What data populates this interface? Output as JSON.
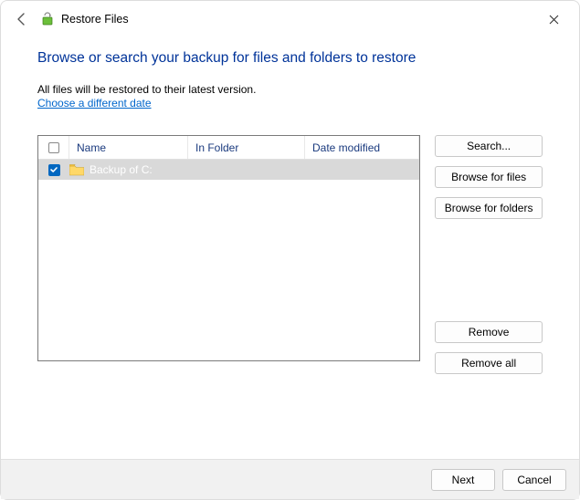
{
  "window": {
    "title": "Restore Files"
  },
  "main": {
    "heading": "Browse or search your backup for files and folders to restore",
    "subtext": "All files will be restored to their latest version.",
    "link": "Choose a different date"
  },
  "list": {
    "columns": {
      "name": "Name",
      "folder": "In Folder",
      "date": "Date modified"
    },
    "rows": [
      {
        "name": "Backup of C:",
        "folder": "",
        "date": ""
      }
    ]
  },
  "sidebuttons": {
    "search": "Search...",
    "browse_files": "Browse for files",
    "browse_folders": "Browse for folders",
    "remove": "Remove",
    "remove_all": "Remove all"
  },
  "footer": {
    "next": "Next",
    "cancel": "Cancel"
  }
}
